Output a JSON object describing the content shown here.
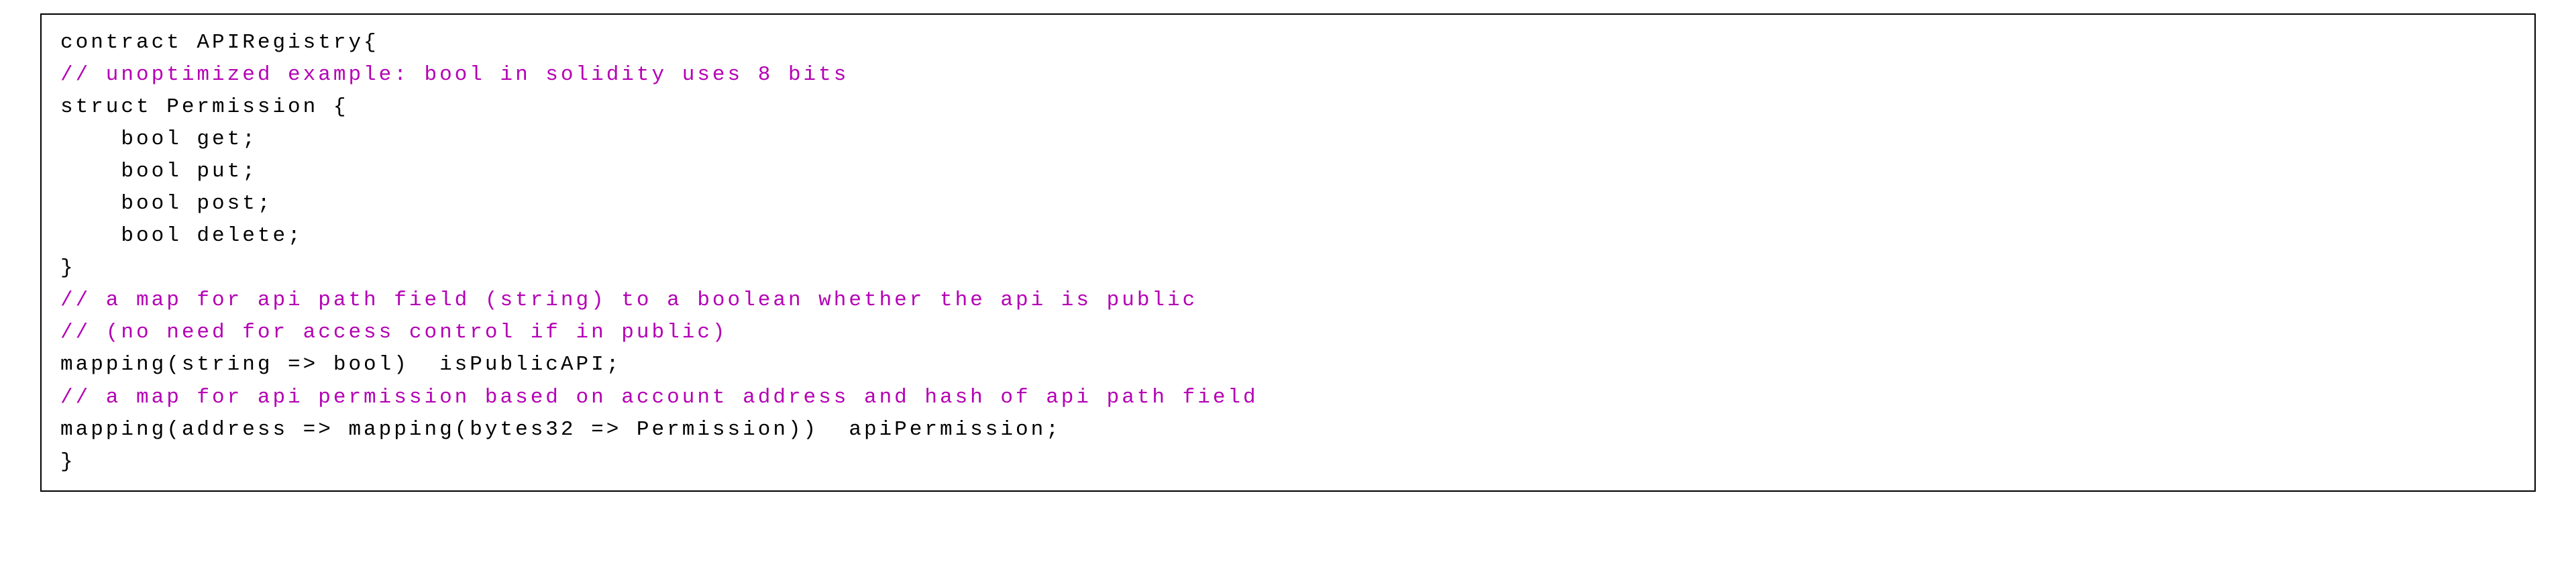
{
  "code": {
    "lines": [
      {
        "indent": 0,
        "segments": [
          {
            "cls": "kw",
            "text": "contract APIRegistry{"
          }
        ]
      },
      {
        "indent": 0,
        "segments": [
          {
            "cls": "cm",
            "text": "// unoptimized example: bool in solidity uses 8 bits"
          }
        ]
      },
      {
        "indent": 0,
        "segments": [
          {
            "cls": "kw",
            "text": "struct Permission {"
          }
        ]
      },
      {
        "indent": 1,
        "segments": [
          {
            "cls": "kw",
            "text": "bool get;"
          }
        ]
      },
      {
        "indent": 1,
        "segments": [
          {
            "cls": "kw",
            "text": "bool put;"
          }
        ]
      },
      {
        "indent": 1,
        "segments": [
          {
            "cls": "kw",
            "text": "bool post;"
          }
        ]
      },
      {
        "indent": 1,
        "segments": [
          {
            "cls": "kw",
            "text": "bool delete;"
          }
        ]
      },
      {
        "indent": 0,
        "segments": [
          {
            "cls": "kw",
            "text": "}"
          }
        ]
      },
      {
        "indent": 0,
        "segments": [
          {
            "cls": "cm",
            "text": "// a map for api path field (string) to a boolean whether the api is public"
          }
        ]
      },
      {
        "indent": 0,
        "segments": [
          {
            "cls": "cm",
            "text": "// (no need for access control if in public)"
          }
        ]
      },
      {
        "indent": 0,
        "segments": [
          {
            "cls": "kw",
            "text": "mapping(string => bool)  isPublicAPI;"
          }
        ]
      },
      {
        "indent": 0,
        "segments": [
          {
            "cls": "cm",
            "text": "// a map for api permission based on account address and hash of api path field"
          }
        ]
      },
      {
        "indent": 0,
        "segments": [
          {
            "cls": "kw",
            "text": "mapping(address => mapping(bytes32 => Permission))  apiPermission;"
          }
        ]
      },
      {
        "indent": 0,
        "segments": [
          {
            "cls": "kw",
            "text": "}"
          }
        ]
      }
    ],
    "indent_unit": "    "
  }
}
